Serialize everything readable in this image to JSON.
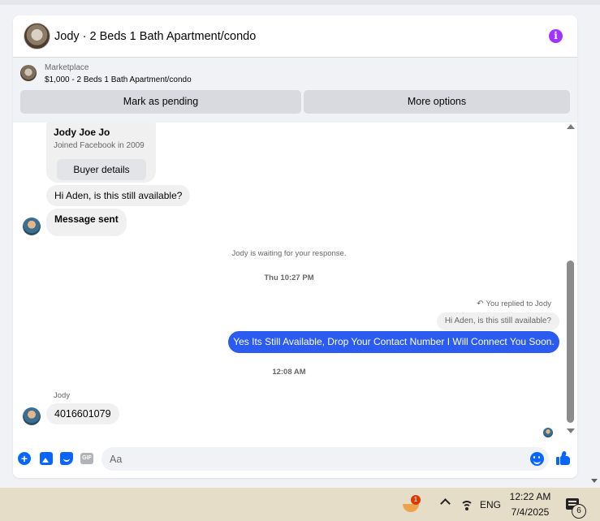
{
  "header": {
    "title": "Jody · 2 Beds 1 Bath Apartment/condo",
    "info_icon": "info-icon"
  },
  "marketplace": {
    "kicker": "Marketplace",
    "listing": "$1,000 - 2 Beds 1 Bath Apartment/condo",
    "mark_pending_label": "Mark as pending",
    "more_options_label": "More options"
  },
  "buyer_card": {
    "name": "Jody Joe Jo",
    "joined": "Joined Facebook in 2009",
    "buyer_details_label": "Buyer details"
  },
  "messages": {
    "incoming_1": "Hi Aden, is this still available?",
    "incoming_2": "Message sent",
    "waiting_notice": "Jody is waiting for your response.",
    "timestamp_1": "Thu 10:27 PM",
    "replied_label": "You replied to Jody",
    "quoted": "Hi Aden, is this still available?",
    "outgoing": "Yes Its Still Available, Drop Your Contact Number I Will Connect You Soon.",
    "timestamp_2": "12:08 AM",
    "sender_name": "Jody",
    "incoming_3": "4016601079"
  },
  "composer": {
    "placeholder": "Aa",
    "gif_label": "GIF"
  },
  "taskbar": {
    "app_badge": "1",
    "language": "ENG",
    "time": "12:22 AM",
    "date": "7/4/2025",
    "notification_count": "6"
  },
  "colors": {
    "accent": "#0866ff",
    "outgoing_bubble": "#2b5bf0",
    "info": "#a033ff"
  }
}
